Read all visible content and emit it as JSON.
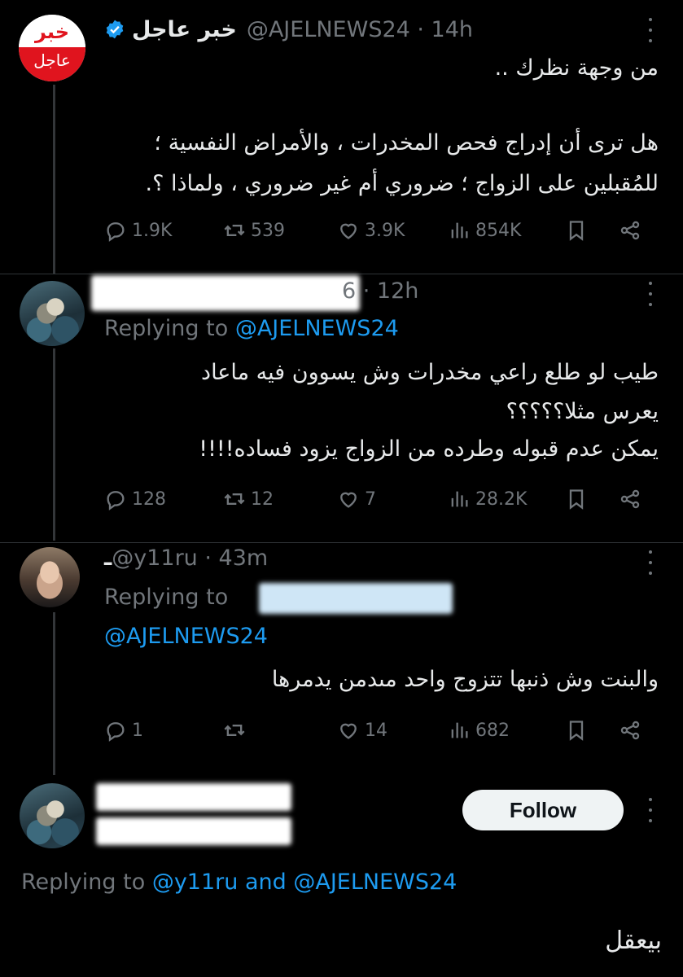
{
  "tweet1": {
    "avatar_top": "خبر",
    "avatar_bottom": "عاجل",
    "name": "خبر عاجل",
    "handle_time": "@AJELNEWS24 · 14h",
    "line1": "من وجهة نظرك ..",
    "line2": "هل ترى أن إدراج فحص المخدرات ، والأمراض النفسية ؛",
    "line3": "للمُقبلين على الزواج ؛ ضروري أم غير ضروري ، ولماذا ؟.",
    "replies": "1.9K",
    "retweets": "539",
    "likes": "3.9K",
    "views": "854K"
  },
  "tweet2": {
    "handle_time": "6 · 12h",
    "replying_prefix": "Replying to ",
    "replying_handle": "@AJELNEWS24",
    "line1": "طيب لو طلع راعي مخدرات وش يسوون فيه ماعاد",
    "line2": "يعرس مثلا؟؟؟؟؟",
    "line3": "يمكن عدم قبوله وطرده من الزواج يزود فساده!!!!",
    "replies": "128",
    "retweets": "12",
    "likes": "7",
    "views": "28.2K"
  },
  "tweet3": {
    "handle_time": "@y11ru · 43m",
    "name_mark": "ـ",
    "replying_prefix": "Replying to",
    "replying_handle": "@AJELNEWS24",
    "line1": "والبنت وش ذنبها تتزوج واحد مىدمن يدمرها",
    "replies": "1",
    "retweets": "",
    "likes": "14",
    "views": "682"
  },
  "tweet4": {
    "follow_label": "Follow",
    "replying_prefix": "Replying to ",
    "replying_user1": "@y11ru",
    "replying_and": " and ",
    "replying_user2": "@AJELNEWS24",
    "text": "بيعقل"
  },
  "colors": {
    "background": "#000000",
    "text": "#e7e9ea",
    "muted": "#71767b",
    "link": "#1d9bf0",
    "verified": "#1d9bf0",
    "brand_red": "#e0141e"
  },
  "icons": [
    "reply-icon",
    "retweet-icon",
    "like-icon",
    "views-icon",
    "bookmark-icon",
    "share-icon",
    "more-icon",
    "verified-icon"
  ]
}
